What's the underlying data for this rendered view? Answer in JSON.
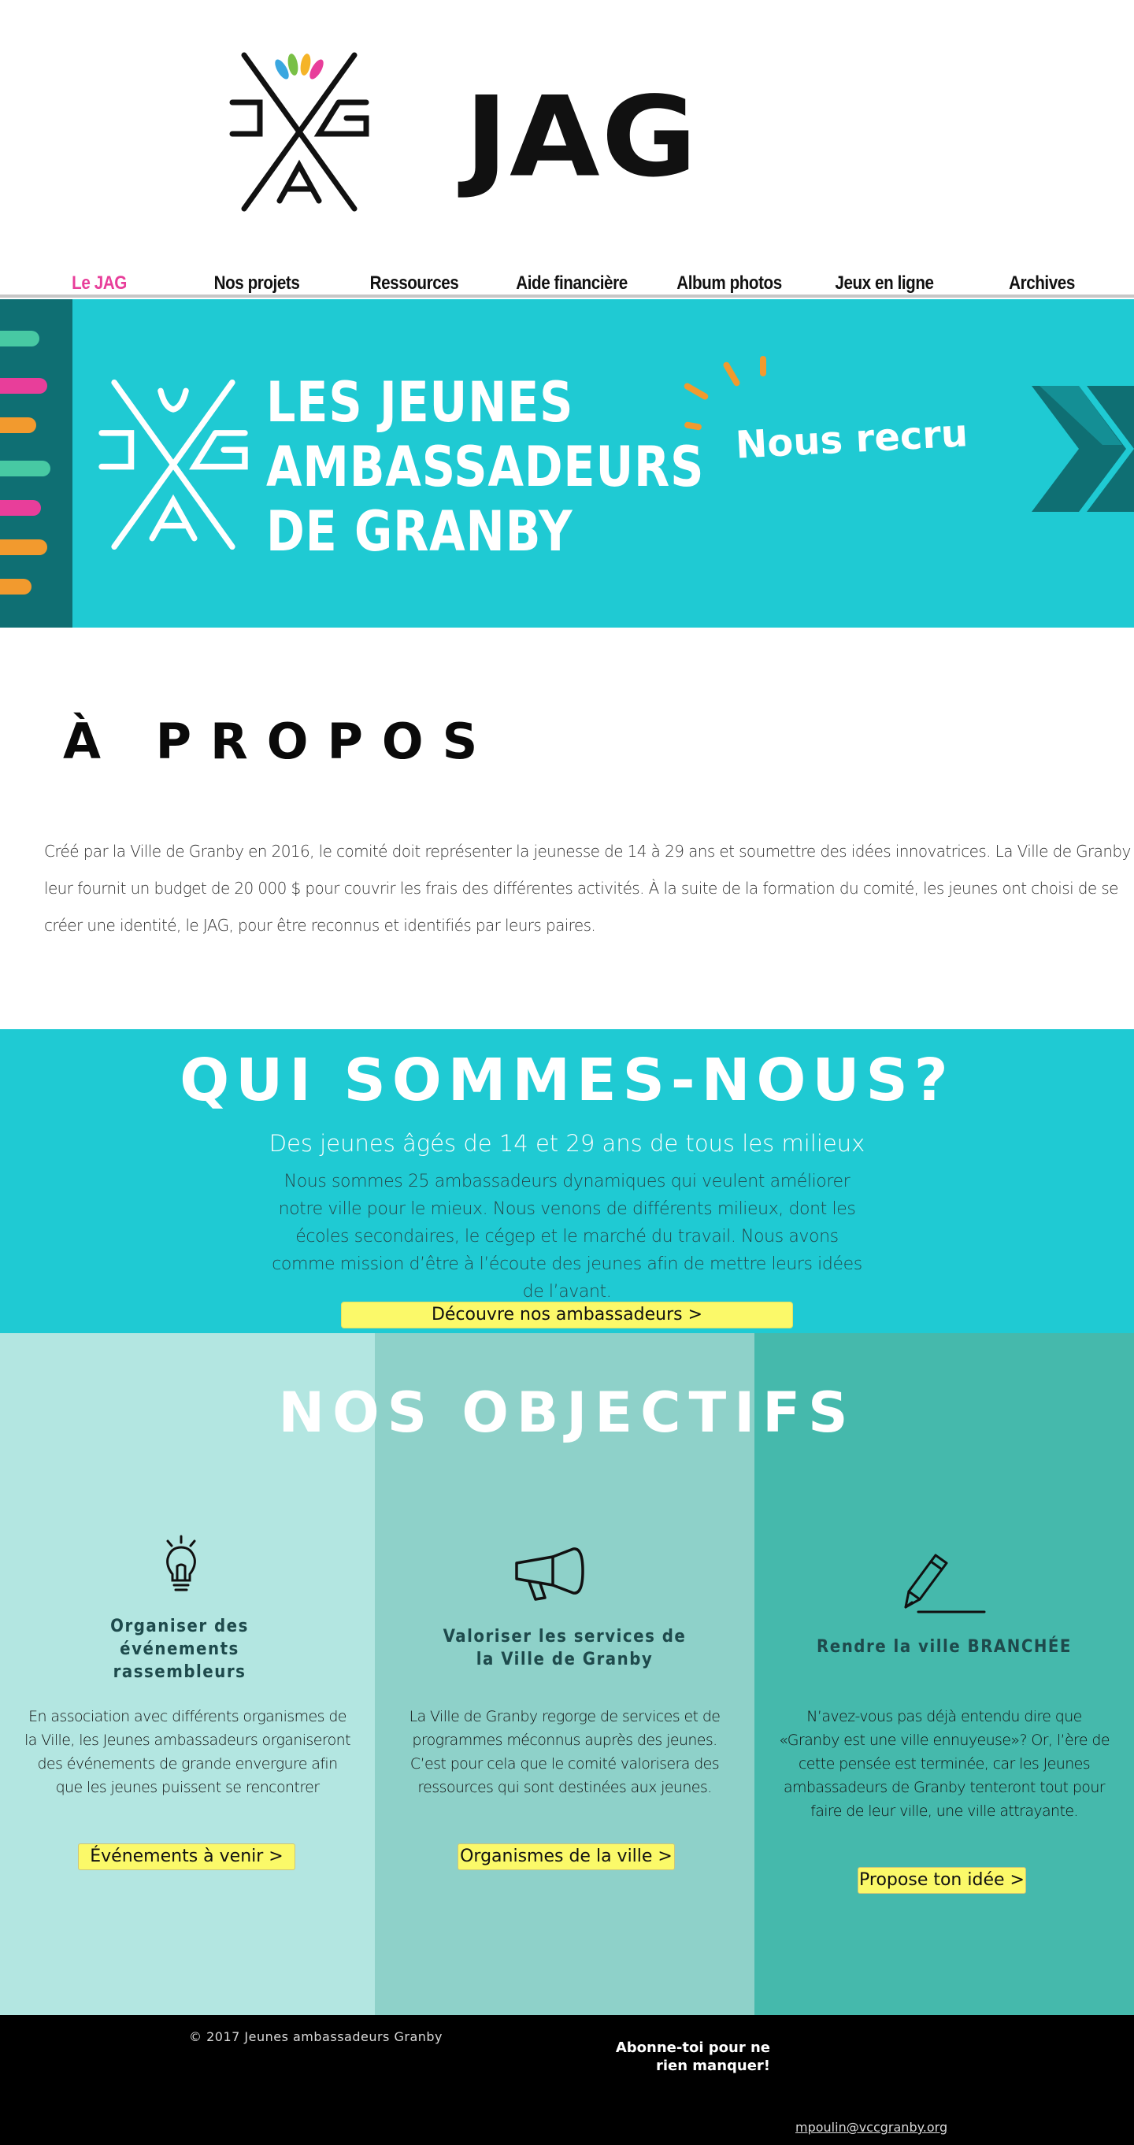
{
  "header": {
    "logo_word": "JAG"
  },
  "nav": {
    "items": [
      {
        "label": "Le JAG",
        "active": true
      },
      {
        "label": "Nos projets",
        "active": false
      },
      {
        "label": "Ressources",
        "active": false
      },
      {
        "label": "Aide financière",
        "active": false
      },
      {
        "label": "Album photos",
        "active": false
      },
      {
        "label": "Jeux en ligne",
        "active": false
      },
      {
        "label": "Archives",
        "active": false
      }
    ],
    "active_color": "#e83e9a"
  },
  "banner": {
    "line1": "LES JEUNES",
    "line2": "AMBASSADEURS",
    "line3": "DE GRANBY",
    "recruit": "Nous recru",
    "bg_color": "#1fcad3"
  },
  "apropos": {
    "title": "À PROPOS",
    "text": "Créé par la Ville de Granby en 2016, le comité doit représenter la jeunesse de 14 à 29 ans et soumettre des idées innovatrices. La Ville de Granby leur fournit un budget de 20 000 $ pour couvrir les frais des différentes activités. À la suite de la formation du comité, les jeunes ont choisi de se créer une identité, le JAG, pour être reconnus et identifiés par leurs paires."
  },
  "qui": {
    "title": "QUI SOMMES-NOUS?",
    "subtitle": "Des jeunes âgés de 14 et 29 ans de tous les milieux",
    "text": "Nous sommes 25 ambassadeurs dynamiques qui veulent améliorer notre ville pour le mieux. Nous venons de différents milieux, dont les écoles secondaires, le cégep et le marché du travail. Nous avons comme mission d’être à l’écoute des jeunes afin de mettre leurs idées de l’avant.",
    "button": "Découvre nos ambassadeurs >"
  },
  "objectifs": {
    "title": "NOS OBJECTIFS",
    "columns": [
      {
        "icon": "lightbulb-icon",
        "heading": "Organiser des événements rassembleurs",
        "text": "En association avec différents organismes de la Ville, les Jeunes ambassadeurs organiseront des événements de grande envergure afin que les jeunes puissent se rencontrer",
        "button": "Événements à venir >"
      },
      {
        "icon": "megaphone-icon",
        "heading": "Valoriser les services de la Ville de Granby",
        "text": "La Ville de Granby regorge de services et de programmes méconnus auprès des jeunes. C’est pour cela que le comité valorisera des ressources qui sont destinées aux jeunes.",
        "button": "Organismes de la ville >"
      },
      {
        "icon": "pencil-icon",
        "heading": "Rendre la ville BRANCHÉE",
        "text": "N’avez-vous pas déjà entendu dire que «Granby est une ville ennuyeuse»? Or, l’ère de cette pensée est terminée, car les Jeunes ambassadeurs de Granby tenteront tout pour faire de leur ville, une ville attrayante.",
        "button": "Propose ton idée >"
      }
    ],
    "colors": [
      "#b3e6e1",
      "#8ed1c9",
      "#45b9ac"
    ]
  },
  "footer": {
    "copyright": "© 2017 Jeunes ambassadeurs Granby",
    "subscribe_line1": "Abonne-toi pour ne",
    "subscribe_line2": "rien manquer!",
    "email": "mpoulin@vccgranby.org"
  }
}
